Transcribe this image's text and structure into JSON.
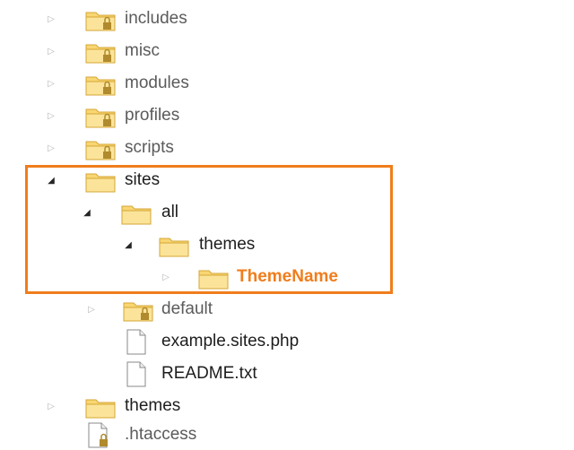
{
  "tree": {
    "items": [
      {
        "label": "includes",
        "type": "folder",
        "lock": true,
        "expanded": false
      },
      {
        "label": "misc",
        "type": "folder",
        "lock": true,
        "expanded": false
      },
      {
        "label": "modules",
        "type": "folder",
        "lock": true,
        "expanded": false
      },
      {
        "label": "profiles",
        "type": "folder",
        "lock": true,
        "expanded": false
      },
      {
        "label": "scripts",
        "type": "folder",
        "lock": true,
        "expanded": false
      },
      {
        "label": "sites",
        "type": "folder",
        "lock": false,
        "expanded": true
      },
      {
        "label": "all",
        "type": "folder",
        "lock": false,
        "expanded": true
      },
      {
        "label": "themes",
        "type": "folder",
        "lock": false,
        "expanded": true
      },
      {
        "label": "ThemeName",
        "type": "folder",
        "lock": false,
        "expanded": false
      },
      {
        "label": "default",
        "type": "folder",
        "lock": true,
        "expanded": false
      },
      {
        "label": "example.sites.php",
        "type": "file",
        "lock": false
      },
      {
        "label": "README.txt",
        "type": "file",
        "lock": false
      },
      {
        "label": "themes",
        "type": "folder",
        "lock": false,
        "expanded": false
      },
      {
        "label": ".htaccess",
        "type": "file",
        "lock": true
      }
    ]
  },
  "colors": {
    "highlight": "#f07d1c",
    "folder_fill": "#f8d673",
    "folder_edge": "#d6a634",
    "lock": "#b08a2c"
  }
}
